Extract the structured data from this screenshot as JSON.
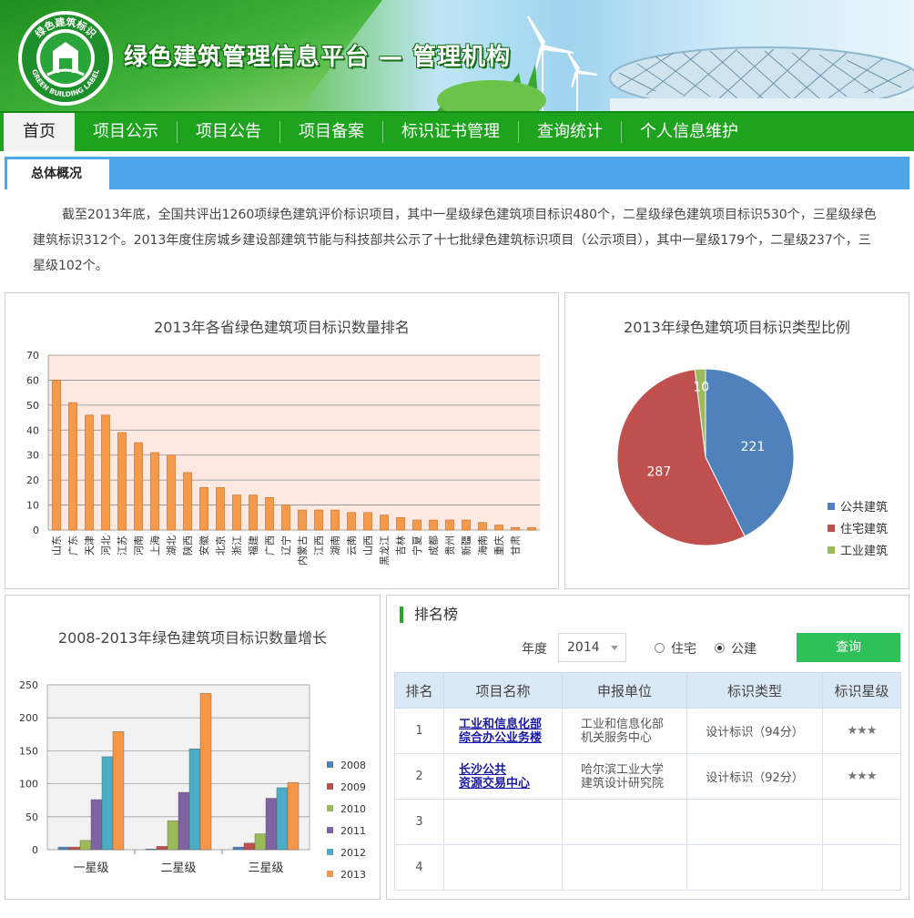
{
  "header": {
    "site_title": "绿色建筑管理信息平台 — 管理机构",
    "logo_ring_text": "绿色建筑标识",
    "logo_bottom_text": "GREEN BUILDING LABEL"
  },
  "nav": {
    "items": [
      {
        "label": "首页",
        "active": true
      },
      {
        "label": "项目公示"
      },
      {
        "label": "项目公告"
      },
      {
        "label": "项目备案"
      },
      {
        "label": "标识证书管理"
      },
      {
        "label": "查询统计"
      },
      {
        "label": "个人信息维护"
      }
    ]
  },
  "section": {
    "tab_label": "总体概况"
  },
  "summary": {
    "text": "截至2013年底，全国共评出1260项绿色建筑评价标识项目，其中一星级绿色建筑项目标识480个，二星级绿色建筑项目标识530个，三星级绿色建筑标识312个。2013年度住房城乡建设部建筑节能与科技部共公示了十七批绿色建筑标识项目（公示项目），其中一星级179个，二星级237个，三星级102个。"
  },
  "chart_data": [
    {
      "type": "bar",
      "title": "2013年各省绿色建筑项目标识数量排名",
      "categories": [
        "山东",
        "广东",
        "天津",
        "河北",
        "江苏",
        "河南",
        "上海",
        "湖北",
        "陕西",
        "安徽",
        "北京",
        "浙江",
        "福建",
        "广西",
        "辽宁",
        "内蒙古",
        "江西",
        "湖南",
        "云南",
        "山西",
        "黑龙江",
        "吉林",
        "宁夏",
        "成都",
        "贵州",
        "新疆",
        "海南",
        "重庆",
        "甘肃"
      ],
      "values": [
        60,
        51,
        46,
        46,
        39,
        35,
        31,
        30,
        23,
        17,
        17,
        14,
        14,
        13,
        10,
        8,
        8,
        8,
        7,
        7,
        6,
        5,
        4,
        4,
        4,
        4,
        3,
        2,
        1,
        1
      ],
      "ylim": [
        0,
        70
      ],
      "yticks": [
        0,
        10,
        20,
        30,
        40,
        50,
        60,
        70
      ],
      "color": "#f59a4b",
      "plot_background": "#fde9e1",
      "grid": true
    },
    {
      "type": "pie",
      "title": "2013年绿色建筑项目标识类型比例",
      "slices": [
        {
          "name": "公共建筑",
          "value": 221,
          "color": "#4f81bd"
        },
        {
          "name": "住宅建筑",
          "value": 287,
          "color": "#c0504d"
        },
        {
          "name": "工业建筑",
          "value": 10,
          "color": "#9bbb59"
        }
      ],
      "legend": "bottom-right"
    },
    {
      "type": "bar",
      "title": "2008-2013年绿色建筑项目标识数量增长",
      "categories": [
        "一星级",
        "二星级",
        "三星级"
      ],
      "series": [
        {
          "name": "2008",
          "values": [
            4,
            1,
            4
          ],
          "color": "#4f81bd"
        },
        {
          "name": "2009",
          "values": [
            4,
            5,
            10
          ],
          "color": "#c0504d"
        },
        {
          "name": "2010",
          "values": [
            14,
            44,
            24
          ],
          "color": "#9bbb59"
        },
        {
          "name": "2011",
          "values": [
            76,
            87,
            78
          ],
          "color": "#8064a2"
        },
        {
          "name": "2012",
          "values": [
            141,
            153,
            94
          ],
          "color": "#4bacc6"
        },
        {
          "name": "2013",
          "values": [
            179,
            237,
            102
          ],
          "color": "#f79646"
        }
      ],
      "ylim": [
        0,
        250
      ],
      "yticks": [
        0,
        50,
        100,
        150,
        200,
        250
      ],
      "legend": "right",
      "grid": true
    }
  ],
  "ranking": {
    "heading": "排名榜",
    "year_label": "年度",
    "year_value": "2014",
    "radio_options": [
      {
        "label": "住宅",
        "checked": false
      },
      {
        "label": "公建",
        "checked": true
      }
    ],
    "query_label": "查询",
    "columns": [
      "排名",
      "项目名称",
      "申报单位",
      "标识类型",
      "标识星级"
    ],
    "rows": [
      {
        "rank": "1",
        "name_line1": "工业和信息化部",
        "name_line2": "综合办公业务楼",
        "unit_line1": "工业和信息化部",
        "unit_line2": "机关服务中心",
        "type": "设计标识（94分）",
        "stars": "★★★"
      },
      {
        "rank": "2",
        "name_line1": "长沙公共",
        "name_line2": "资源交易中心",
        "unit_line1": "哈尔滨工业大学",
        "unit_line2": "建筑设计研究院",
        "type": "设计标识（92分）",
        "stars": "★★★"
      },
      {
        "rank": "3",
        "name_line1": "",
        "name_line2": "",
        "unit_line1": "",
        "unit_line2": "",
        "type": "",
        "stars": ""
      },
      {
        "rank": "4",
        "name_line1": "",
        "name_line2": "",
        "unit_line1": "",
        "unit_line2": "",
        "type": "",
        "stars": ""
      }
    ]
  }
}
